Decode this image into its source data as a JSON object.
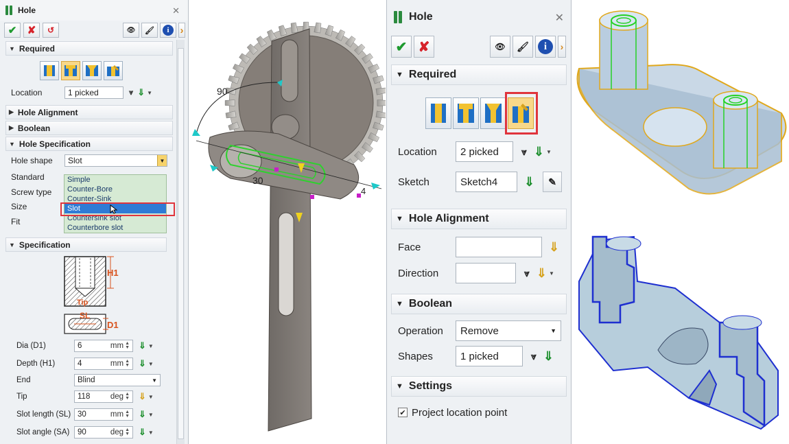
{
  "left_panel": {
    "title": "Hole",
    "close": "✕",
    "toolbar": {
      "ok": "✔",
      "cancel": "✘",
      "apply": "↺",
      "preview": "👁",
      "brush": "🖌",
      "info": "i",
      "help": "›"
    },
    "sections": {
      "required": "Required",
      "hole_alignment": "Hole Alignment",
      "boolean": "Boolean",
      "hole_specification": "Hole Specification",
      "specification": "Specification"
    },
    "location": {
      "label": "Location",
      "value": "1 picked"
    },
    "hole_shape": {
      "label": "Hole shape",
      "value": "Slot",
      "options": [
        "Simple",
        "Counter-Bore",
        "Counter-Sink",
        "Slot",
        "Countersink slot",
        "Counterbore slot"
      ],
      "selected": "Slot"
    },
    "side_labels": {
      "standard": "Standard",
      "screw_type": "Screw type",
      "size": "Size",
      "fit": "Fit"
    },
    "diagram": {
      "h1": "H1",
      "tip": "Tip",
      "sl": "SL",
      "d1": "D1"
    },
    "params": [
      {
        "label": "Dia (D1)",
        "value": "6",
        "unit": "mm"
      },
      {
        "label": "Depth (H1)",
        "value": "4",
        "unit": "mm"
      },
      {
        "label": "End",
        "value": "Blind",
        "unit": ""
      },
      {
        "label": "Tip",
        "value": "118",
        "unit": "deg"
      },
      {
        "label": "Slot length (SL)",
        "value": "30",
        "unit": "mm"
      },
      {
        "label": "Slot angle (SA)",
        "value": "90",
        "unit": "deg"
      }
    ]
  },
  "viewport": {
    "dim_angle": "90",
    "dim_len": "30",
    "dim_small": "4"
  },
  "right_panel": {
    "title": "Hole",
    "close": "✕",
    "sections": {
      "required": "Required",
      "hole_alignment": "Hole Alignment",
      "boolean": "Boolean",
      "settings": "Settings"
    },
    "location": {
      "label": "Location",
      "value": "2 picked"
    },
    "sketch": {
      "label": "Sketch",
      "value": "Sketch4"
    },
    "face": {
      "label": "Face",
      "value": ""
    },
    "direction": {
      "label": "Direction",
      "value": ""
    },
    "operation": {
      "label": "Operation",
      "value": "Remove"
    },
    "shapes": {
      "label": "Shapes",
      "value": "1 picked"
    },
    "project_location": {
      "label": "Project location point",
      "checked": true
    }
  },
  "colors": {
    "accent_green": "#1e8f2e",
    "highlight_red": "#e0343c",
    "selected_blue": "#2f7bd5"
  }
}
